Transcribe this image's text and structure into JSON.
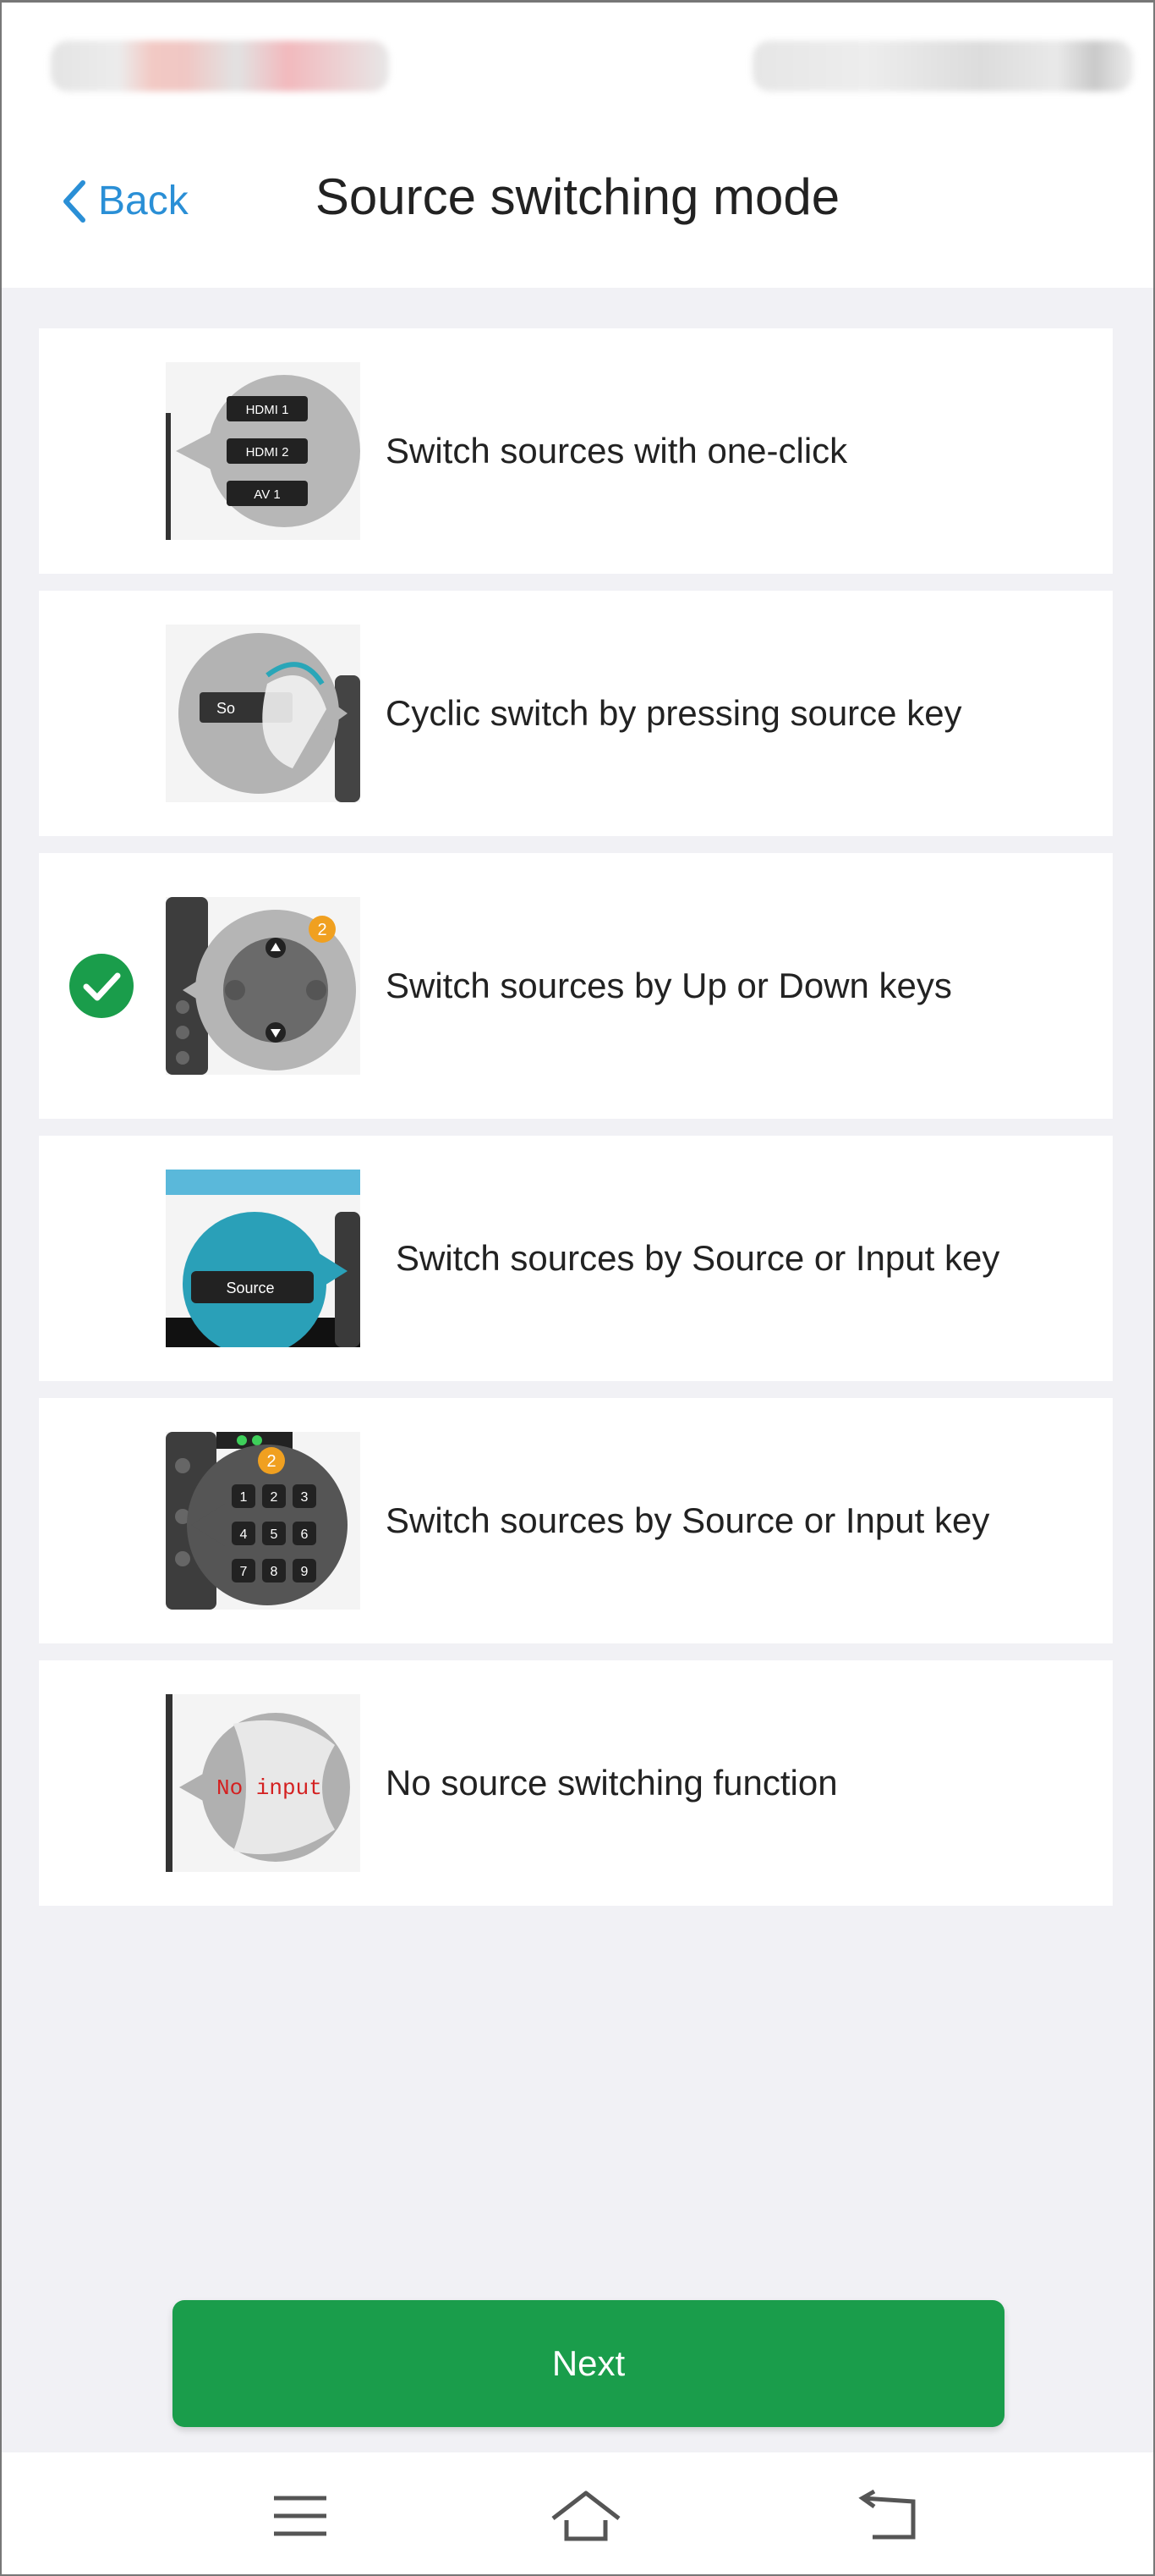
{
  "header": {
    "back_label": "Back",
    "title": "Source switching mode"
  },
  "options": [
    {
      "label": "Switch sources with one-click",
      "thumb_texts": [
        "HDMI 1",
        "HDMI 2",
        "AV 1"
      ],
      "selected": false
    },
    {
      "label": "Cyclic switch by pressing source key",
      "thumb_texts": [
        "So"
      ],
      "selected": false
    },
    {
      "label": "Switch sources by Up or Down keys",
      "badge": "2",
      "selected": true
    },
    {
      "label": "Switch sources by Source or Input key",
      "thumb_texts": [
        "Source"
      ],
      "selected": false
    },
    {
      "label": "Switch sources by Source or Input key",
      "badge": "2",
      "keys": [
        "1",
        "2",
        "3",
        "4",
        "5",
        "6",
        "7",
        "8",
        "9"
      ],
      "selected": false
    },
    {
      "label": "No source switching function",
      "thumb_texts": [
        "No input"
      ],
      "selected": false
    }
  ],
  "next_label": "Next",
  "colors": {
    "accent_green": "#1a9d4b",
    "link_blue": "#2a8fd6",
    "badge_orange": "#f0a020"
  },
  "icons": {
    "back": "chevron-left-icon",
    "check": "check-circle-icon",
    "menu": "menu-icon",
    "home": "home-icon",
    "return": "back-arrow-icon"
  }
}
